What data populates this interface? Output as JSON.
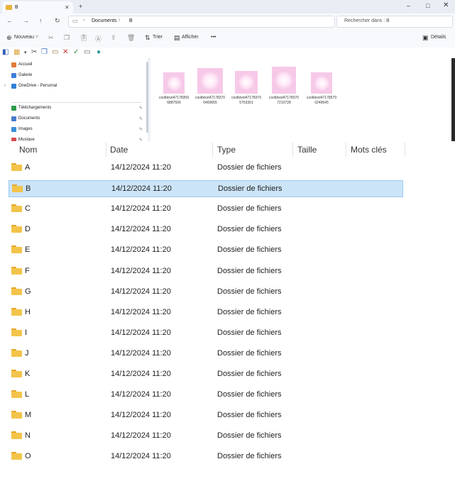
{
  "top_window": {
    "tab_title": "B",
    "new_tab": "+",
    "controls": {
      "minimize": "–",
      "maximize": "□",
      "close": "✕"
    },
    "nav_icons": [
      "back-icon",
      "forward-icon",
      "up-icon",
      "refresh-icon"
    ],
    "address": {
      "root": "Documents",
      "separator": "›",
      "current": "B"
    },
    "search_placeholder": "Rechercher dans : B",
    "toolbar": {
      "new_label": "Nouveau",
      "sort_label": "Trier",
      "view_label": "Afficher",
      "more_label": "•••",
      "details_label": "Détails"
    },
    "nav_items": [
      {
        "label": "Accueil",
        "color": "#e07b39",
        "pinned": false
      },
      {
        "label": "Galerie",
        "color": "#3b7dd8",
        "pinned": false
      },
      {
        "label": "OneDrive - Personal",
        "color": "#2f7fd6",
        "pinned": false
      },
      {
        "label": "Téléchargements",
        "color": "#2f9a4a",
        "pinned": true
      },
      {
        "label": "Documents",
        "color": "#4a7bc8",
        "pinned": true
      },
      {
        "label": "Images",
        "color": "#3b8fd8",
        "pinned": true
      },
      {
        "label": "Musique",
        "color": "#d84b4b",
        "pinned": true
      }
    ],
    "thumbnails": [
      {
        "line1": "coolbtxxt47178359",
        "line2": "6887506"
      },
      {
        "line1": "coolbtxxt47178370",
        "line2": "0460655"
      },
      {
        "line1": "coolbtxxt47178370",
        "line2": "5753301"
      },
      {
        "line1": "coolbtxxt47178370",
        "line2": "7210728"
      },
      {
        "line1": "coolbtxxt47178579",
        "line2": "0249545"
      }
    ]
  },
  "list": {
    "columns": [
      "Nom",
      "Date",
      "Type",
      "Taille",
      "Mots clés"
    ],
    "selected_index": 1,
    "rows": [
      {
        "name": "A",
        "date": "14/12/2024 11:20",
        "type": "Dossier de fichiers"
      },
      {
        "name": "B",
        "date": "14/12/2024 11:20",
        "type": "Dossier de fichiers"
      },
      {
        "name": "C",
        "date": "14/12/2024 11:20",
        "type": "Dossier de fichiers"
      },
      {
        "name": "D",
        "date": "14/12/2024 11:20",
        "type": "Dossier de fichiers"
      },
      {
        "name": "E",
        "date": "14/12/2024 11:20",
        "type": "Dossier de fichiers"
      },
      {
        "name": "F",
        "date": "14/12/2024 11:20",
        "type": "Dossier de fichiers"
      },
      {
        "name": "G",
        "date": "14/12/2024 11:20",
        "type": "Dossier de fichiers"
      },
      {
        "name": "H",
        "date": "14/12/2024 11:20",
        "type": "Dossier de fichiers"
      },
      {
        "name": "I",
        "date": "14/12/2024 11:20",
        "type": "Dossier de fichiers"
      },
      {
        "name": "J",
        "date": "14/12/2024 11:20",
        "type": "Dossier de fichiers"
      },
      {
        "name": "K",
        "date": "14/12/2024 11:20",
        "type": "Dossier de fichiers"
      },
      {
        "name": "L",
        "date": "14/12/2024 11:20",
        "type": "Dossier de fichiers"
      },
      {
        "name": "M",
        "date": "14/12/2024 11:20",
        "type": "Dossier de fichiers"
      },
      {
        "name": "N",
        "date": "14/12/2024 11:20",
        "type": "Dossier de fichiers"
      },
      {
        "name": "O",
        "date": "14/12/2024 11:20",
        "type": "Dossier de fichiers"
      }
    ]
  }
}
